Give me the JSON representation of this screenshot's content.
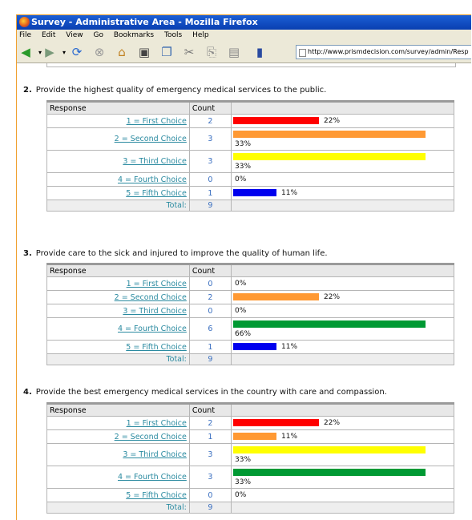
{
  "window": {
    "title": "Survey - Administrative Area - Mozilla Firefox"
  },
  "menu": [
    "File",
    "Edit",
    "View",
    "Go",
    "Bookmarks",
    "Tools",
    "Help"
  ],
  "address": {
    "url": "http://www.prismdecision.com/survey/admin/Resp"
  },
  "columns": {
    "response": "Response",
    "count": "Count",
    "total": "Total:"
  },
  "colors": {
    "red": "#ff0000",
    "orange": "#ff9933",
    "yellow": "#ffff00",
    "green": "#009933",
    "blue": "#0000ee"
  },
  "questions": [
    {
      "num": "2.",
      "text": "Provide the highest quality of emergency medical services to the public.",
      "rows": [
        {
          "label": "1 = First Choice",
          "count": "2",
          "pct": "22%",
          "fraction": 0.22,
          "color": "red"
        },
        {
          "label": "2 = Second Choice",
          "count": "3",
          "pct": "33%",
          "fraction": 0.33,
          "color": "orange"
        },
        {
          "label": "3 = Third Choice",
          "count": "3",
          "pct": "33%",
          "fraction": 0.33,
          "color": "yellow"
        },
        {
          "label": "4 = Fourth Choice",
          "count": "0",
          "pct": "0%",
          "fraction": 0.0,
          "color": "green"
        },
        {
          "label": "5 = Fifth Choice",
          "count": "1",
          "pct": "11%",
          "fraction": 0.11,
          "color": "blue"
        }
      ],
      "total": "9"
    },
    {
      "num": "3.",
      "text": "Provide care to the sick and injured to improve the quality of human life.",
      "rows": [
        {
          "label": "1 = First Choice",
          "count": "0",
          "pct": "0%",
          "fraction": 0.0,
          "color": "red"
        },
        {
          "label": "2 = Second Choice",
          "count": "2",
          "pct": "22%",
          "fraction": 0.22,
          "color": "orange"
        },
        {
          "label": "3 = Third Choice",
          "count": "0",
          "pct": "0%",
          "fraction": 0.0,
          "color": "yellow"
        },
        {
          "label": "4 = Fourth Choice",
          "count": "6",
          "pct": "66%",
          "fraction": 0.66,
          "color": "green"
        },
        {
          "label": "5 = Fifth Choice",
          "count": "1",
          "pct": "11%",
          "fraction": 0.11,
          "color": "blue"
        }
      ],
      "total": "9"
    },
    {
      "num": "4.",
      "text": "Provide the best emergency medical services in the country with care and compassion.",
      "rows": [
        {
          "label": "1 = First Choice",
          "count": "2",
          "pct": "22%",
          "fraction": 0.22,
          "color": "red"
        },
        {
          "label": "2 = Second Choice",
          "count": "1",
          "pct": "11%",
          "fraction": 0.11,
          "color": "orange"
        },
        {
          "label": "3 = Third Choice",
          "count": "3",
          "pct": "33%",
          "fraction": 0.33,
          "color": "yellow"
        },
        {
          "label": "4 = Fourth Choice",
          "count": "3",
          "pct": "33%",
          "fraction": 0.33,
          "color": "green"
        },
        {
          "label": "5 = Fifth Choice",
          "count": "0",
          "pct": "0%",
          "fraction": 0.0,
          "color": "blue"
        }
      ],
      "total": "9"
    }
  ],
  "toolbar_icons": [
    "back-icon",
    "forward-icon",
    "reload-icon",
    "stop-icon",
    "home-icon",
    "print-icon",
    "new-window-icon",
    "cut-icon",
    "copy-icon",
    "paste-icon",
    "bookmark-icon",
    "page-icon"
  ]
}
